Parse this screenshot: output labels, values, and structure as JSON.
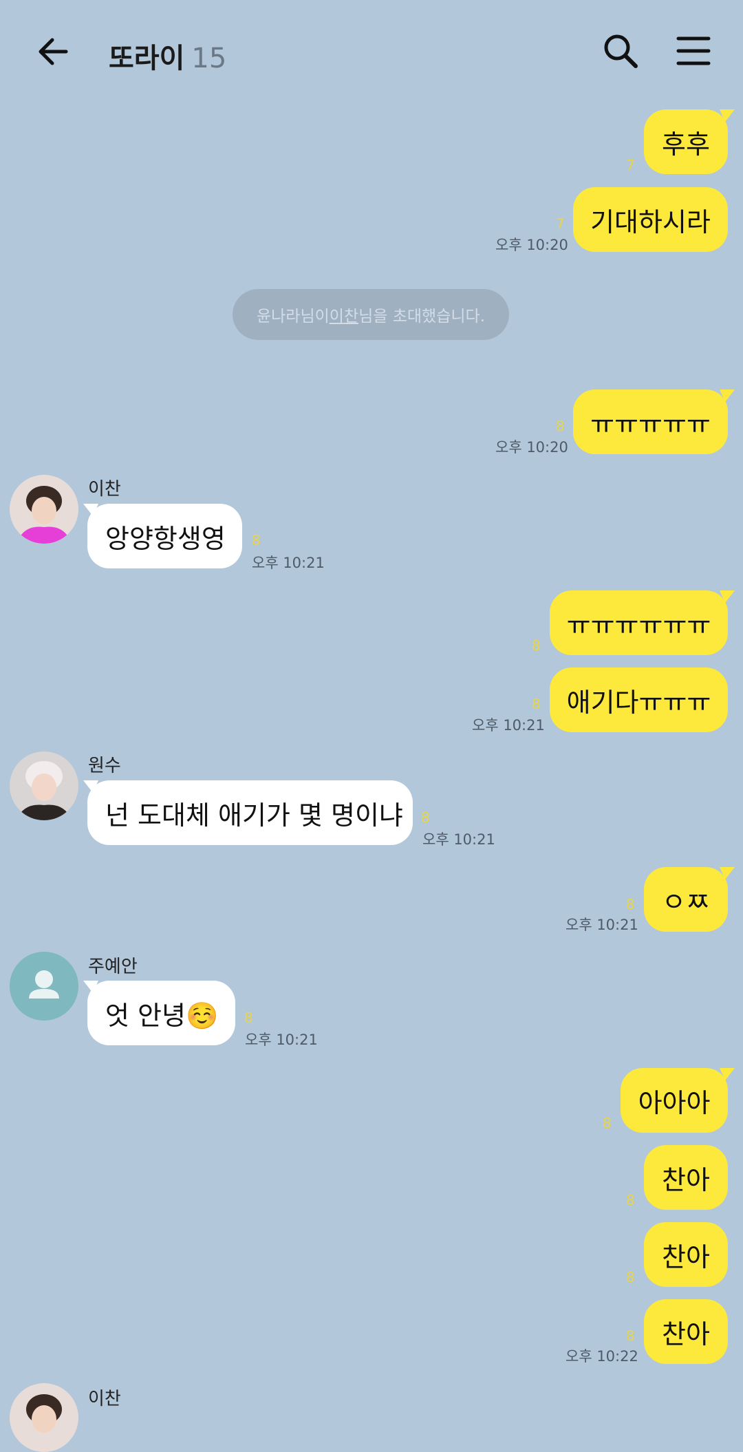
{
  "header": {
    "title": "또라이",
    "member_count": "15"
  },
  "system_notice": {
    "inviter_text": "윤나라님이 ",
    "invited_user": "이찬",
    "suffix_text": "님을 초대했습니다."
  },
  "messages": [
    {
      "id": "m1",
      "from": "me",
      "text": "후후",
      "unread": "7",
      "time": ""
    },
    {
      "id": "m2",
      "from": "me",
      "text": "기대하시라",
      "unread": "7",
      "time": "오후 10:20"
    },
    {
      "id": "m3",
      "from": "me",
      "text": "ㅠㅠㅠㅠㅠ",
      "unread": "8",
      "time": "오후 10:20"
    },
    {
      "id": "m4",
      "from": "이찬",
      "text": "앙양항생영",
      "unread": "8",
      "time": "오후 10:21"
    },
    {
      "id": "m5",
      "from": "me",
      "text": "ㅠㅠㅠㅠㅠㅠ",
      "unread": "8",
      "time": ""
    },
    {
      "id": "m6",
      "from": "me",
      "text": "애기다ㅠㅠㅠ",
      "unread": "8",
      "time": "오후 10:21"
    },
    {
      "id": "m7",
      "from": "원수",
      "text": "넌 도대체 애기가 몇 명이냐",
      "unread": "8",
      "time": "오후 10:21"
    },
    {
      "id": "m8",
      "from": "me",
      "text": "ㅇㅉ",
      "unread": "8",
      "time": "오후 10:21"
    },
    {
      "id": "m9",
      "from": "주예안",
      "text": "엇 안녕☺️",
      "unread": "8",
      "time": "오후 10:21"
    },
    {
      "id": "m10",
      "from": "me",
      "text": "아아아",
      "unread": "8",
      "time": ""
    },
    {
      "id": "m11",
      "from": "me",
      "text": "찬아",
      "unread": "8",
      "time": ""
    },
    {
      "id": "m12",
      "from": "me",
      "text": "찬아",
      "unread": "8",
      "time": ""
    },
    {
      "id": "m13",
      "from": "me",
      "text": "찬아",
      "unread": "8",
      "time": "오후 10:22"
    }
  ],
  "bottom_sender": "이찬",
  "colors": {
    "background": "#b2c7da",
    "my_bubble": "#fde93c",
    "other_bubble": "#ffffff",
    "unread_count": "#e8d44a"
  },
  "icons": {
    "back": "arrow-left-icon",
    "search": "search-icon",
    "menu": "hamburger-menu-icon",
    "default_avatar": "person-icon"
  }
}
